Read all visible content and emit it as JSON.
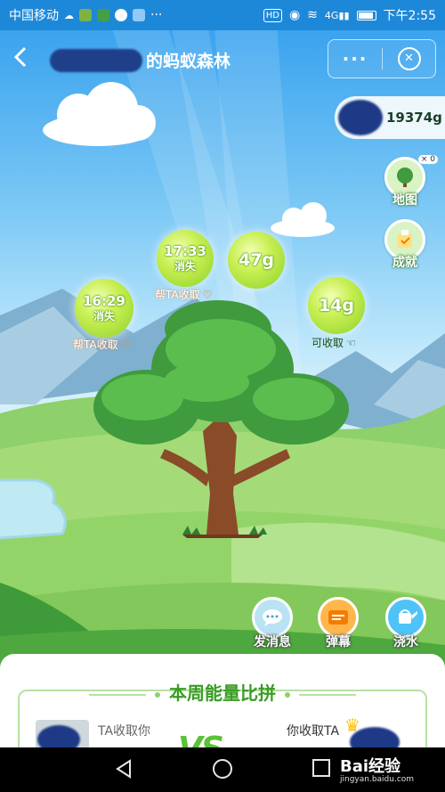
{
  "status_bar": {
    "carrier": "中国移动",
    "network": "4G",
    "time": "下午2:55"
  },
  "header": {
    "back_icon": "chevron-left-icon",
    "title_suffix": "的蚂蚁森林",
    "more_icon": "more-dots-icon",
    "close_icon": "close-circle-icon"
  },
  "friend_energy": {
    "value": "19374g"
  },
  "side_buttons": {
    "map": {
      "label": "地图",
      "badge": "× 0"
    },
    "achievement": {
      "label": "成就"
    }
  },
  "bubbles": [
    {
      "id": "bubble-1729",
      "time": "17:33",
      "status": "消失",
      "caption": "帮TA收取"
    },
    {
      "id": "bubble-47",
      "amount": "47g"
    },
    {
      "id": "bubble-1629",
      "time": "16:29",
      "status": "消失",
      "caption": "帮TA收取"
    },
    {
      "id": "bubble-14",
      "amount": "14g",
      "caption": "可收取"
    }
  ],
  "actions": {
    "message": {
      "label": "发消息",
      "color": "#b9e3f5"
    },
    "danmu": {
      "label": "弹幕",
      "color": "#ffb74d"
    },
    "water": {
      "label": "浇水",
      "color": "#4fc3f7"
    }
  },
  "weekly_panel": {
    "title": "本周能量比拼",
    "left_label": "TA收取你",
    "vs": "VS",
    "right_label": "你收取TA"
  },
  "nav_bar": {
    "back_icon": "nav-back-triangle-icon",
    "home_icon": "nav-home-circle-icon",
    "recent_icon": "nav-recent-square-icon"
  },
  "watermark": {
    "brand": "Bai经验",
    "url": "jingyan.baidu.com"
  }
}
